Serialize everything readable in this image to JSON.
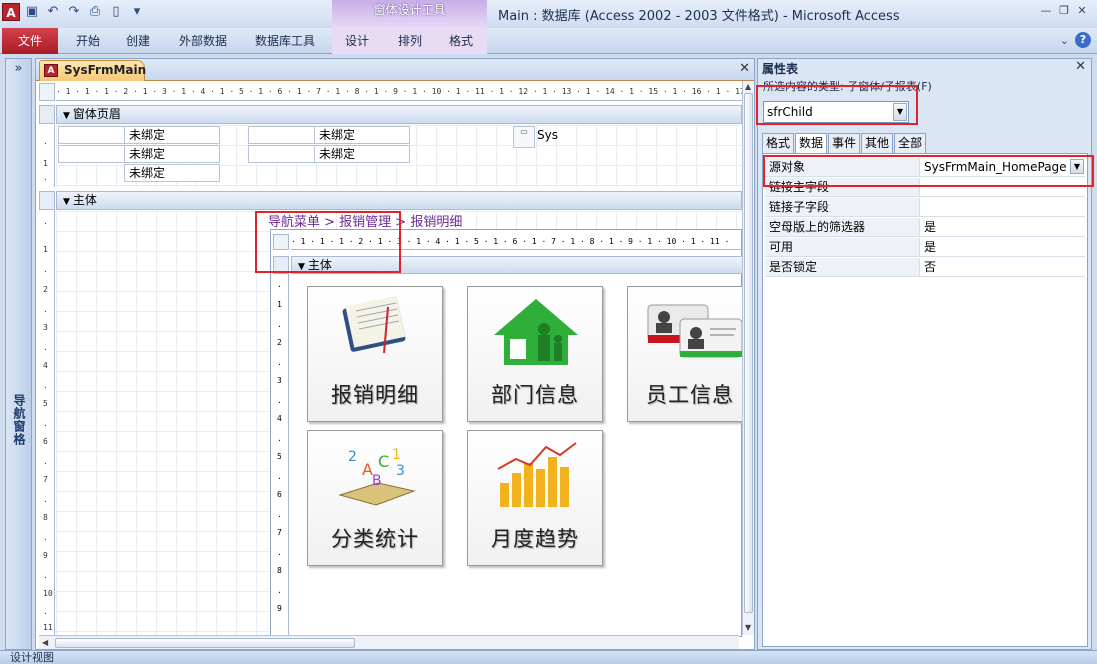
{
  "app": {
    "window_title": "Main : 数据库 (Access 2002 - 2003 文件格式)  -  Microsoft Access",
    "context_tab_group": "窗体设计工具",
    "logo_letter": "A"
  },
  "ribbon": {
    "file_tab": "文件",
    "tabs": [
      "开始",
      "创建",
      "外部数据",
      "数据库工具",
      "设计",
      "排列",
      "格式"
    ]
  },
  "nav_pane": {
    "label": "导航窗格",
    "toggle": "»"
  },
  "document": {
    "tab_title": "SysFrmMain",
    "form_header_label": "窗体页眉",
    "detail_label": "主体",
    "ruler_text": "· 1 · 1 · 1 · 2 · 1 · 3 · 1 · 4 · 1 · 5 · 1 · 6 · 1 · 7 · 1 · 8 · 1 · 9 · 1 · 10 · 1 · 11 · 1 · 12 · 1 · 13 · 1 · 14 · 1 · 15 · 1 · 16 · 1 · 17 · 1 · 18",
    "header_controls": {
      "c1": "未绑定",
      "c2": "未绑定",
      "c3": "未绑定",
      "c4": "未绑定",
      "c5": "未绑定",
      "sys_label": "Sys"
    },
    "breadcrumb": "导航菜单 > 报销管理 > 报销明细",
    "subform": {
      "ruler_text": "· 1 · 1 · 1 · 2 · 1 · 3 · 1 · 4 · 1 · 5 · 1 · 6 · 1 · 7 · 1 · 8 · 1 · 9 · 1 · 10 · 1 · 11 ·",
      "detail_label": "主体",
      "tiles": [
        {
          "label": "报销明细",
          "icon": "notebook-icon"
        },
        {
          "label": "部门信息",
          "icon": "house-family-icon"
        },
        {
          "label": "员工信息",
          "icon": "id-card-icon"
        },
        {
          "label": "分类统计",
          "icon": "abc-book-icon"
        },
        {
          "label": "月度趋势",
          "icon": "bar-chart-icon"
        }
      ]
    }
  },
  "property_sheet": {
    "title": "属性表",
    "selection_type": "所选内容的类型: 子窗体/子报表(F)",
    "selected_control": "sfrChild",
    "tabs": [
      "格式",
      "数据",
      "事件",
      "其他",
      "全部"
    ],
    "active_tab": "数据",
    "rows": [
      {
        "name": "源对象",
        "value": "SysFrmMain_HomePage"
      },
      {
        "name": "链接主字段",
        "value": ""
      },
      {
        "name": "链接子字段",
        "value": ""
      },
      {
        "name": "空母版上的筛选器",
        "value": "是"
      },
      {
        "name": "可用",
        "value": "是"
      },
      {
        "name": "是否锁定",
        "value": "否"
      }
    ]
  },
  "status_bar": {
    "text": "设计视图"
  }
}
